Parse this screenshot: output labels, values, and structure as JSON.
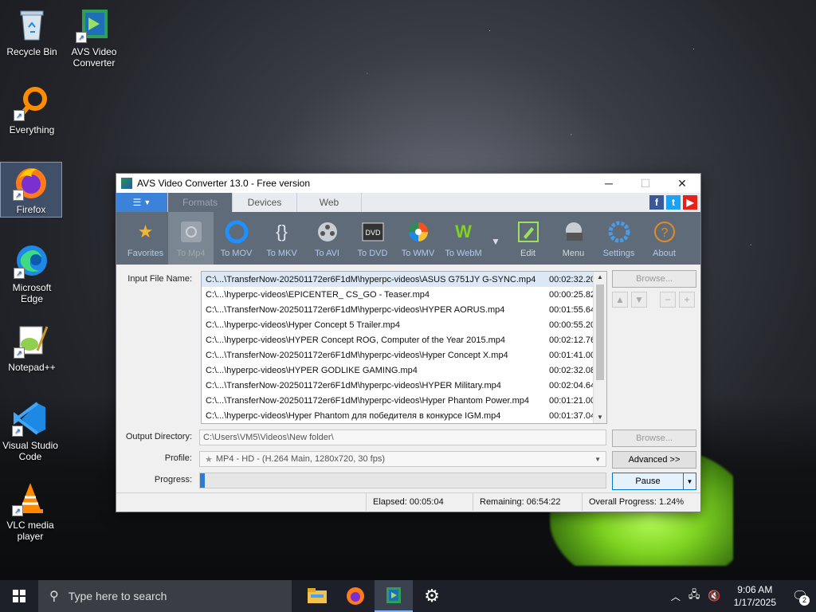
{
  "desktop": {
    "icons": [
      {
        "label": "Recycle Bin"
      },
      {
        "label": "AVS Video\nConverter"
      },
      {
        "label": "Everything"
      },
      {
        "label": "Firefox"
      },
      {
        "label": "Microsoft\nEdge"
      },
      {
        "label": "Notepad++"
      },
      {
        "label": "Visual Studio\nCode"
      },
      {
        "label": "VLC media\nplayer"
      }
    ]
  },
  "window": {
    "title": "AVS Video Converter 13.0 - Free version",
    "tabs": [
      "Formats",
      "Devices",
      "Web"
    ],
    "toolbar": [
      {
        "label": "Favorites"
      },
      {
        "label": "To Mp4"
      },
      {
        "label": "To MOV"
      },
      {
        "label": "To MKV"
      },
      {
        "label": "To AVI"
      },
      {
        "label": "To DVD"
      },
      {
        "label": "To WMV"
      },
      {
        "label": "To WebM"
      },
      {
        "label": "Edit"
      },
      {
        "label": "Menu"
      },
      {
        "label": "Settings"
      },
      {
        "label": "About"
      }
    ],
    "input_label": "Input File Name:",
    "files": [
      {
        "path": "C:\\...\\TransferNow-202501172er6F1dM\\hyperpc-videos\\ASUS G751JY G-SYNC.mp4",
        "duration": "00:02:32.200"
      },
      {
        "path": "C:\\...\\hyperpc-videos\\EPICENTER_ CS_GO - Teaser.mp4",
        "duration": "00:00:25.825"
      },
      {
        "path": "C:\\...\\TransferNow-202501172er6F1dM\\hyperpc-videos\\HYPER AORUS.mp4",
        "duration": "00:01:55.648"
      },
      {
        "path": "C:\\...\\hyperpc-videos\\Hyper Concept 5 Trailer.mp4",
        "duration": "00:00:55.200"
      },
      {
        "path": "C:\\...\\hyperpc-videos\\HYPER Concept ROG, Computer of the Year 2015.mp4",
        "duration": "00:02:12.760"
      },
      {
        "path": "C:\\...\\TransferNow-202501172er6F1dM\\hyperpc-videos\\Hyper Concept X.mp4",
        "duration": "00:01:41.000"
      },
      {
        "path": "C:\\...\\hyperpc-videos\\HYPER GODLIKE GAMING.mp4",
        "duration": "00:02:32.080"
      },
      {
        "path": "C:\\...\\TransferNow-202501172er6F1dM\\hyperpc-videos\\HYPER Military.mp4",
        "duration": "00:02:04.640"
      },
      {
        "path": "C:\\...\\TransferNow-202501172er6F1dM\\hyperpc-videos\\Hyper Phantom Power.mp4",
        "duration": "00:01:21.000"
      },
      {
        "path": "C:\\...\\hyperpc-videos\\Hyper Phantom для победителя в конкурсе IGM.mp4",
        "duration": "00:01:37.040"
      }
    ],
    "browse_label": "Browse...",
    "output_label": "Output Directory:",
    "output_value": "C:\\Users\\VM5\\Videos\\New folder\\",
    "profile_label": "Profile:",
    "profile_value": "MP4 - HD - (H.264 Main, 1280x720, 30 fps)",
    "advanced_label": "Advanced >>",
    "progress_label": "Progress:",
    "progress_fraction": 0.0124,
    "pause_label": "Pause",
    "status": {
      "elapsed": "Elapsed: 00:05:04",
      "remaining": "Remaining: 06:54:22",
      "overall": "Overall Progress: 1.24%"
    }
  },
  "taskbar": {
    "search_placeholder": "Type here to search",
    "time": "9:06 AM",
    "date": "1/17/2025",
    "notifications": "2"
  }
}
